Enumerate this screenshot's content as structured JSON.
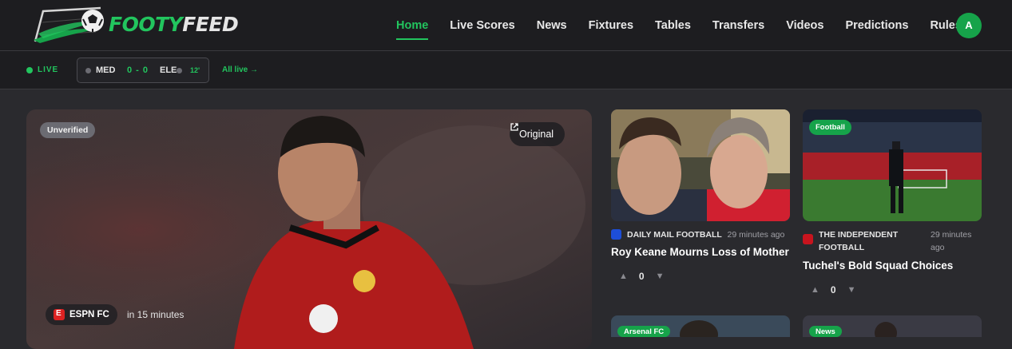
{
  "brand": {
    "name_part1": "FOOTY",
    "name_part2": "FEED"
  },
  "nav": {
    "items": [
      "Home",
      "Live Scores",
      "News",
      "Fixtures",
      "Tables",
      "Transfers",
      "Videos",
      "Predictions",
      "Rules"
    ],
    "active": "Home"
  },
  "user": {
    "initial": "A"
  },
  "live_ticker": {
    "label": "LIVE",
    "match": {
      "home": "MED",
      "score": "0 - 0",
      "away": "ELE",
      "minute": "12'"
    },
    "all_live_link": "All live →"
  },
  "hero": {
    "badge": "Unverified",
    "original_label": "Original",
    "source": "ESPN FC",
    "time": "in 15 minutes"
  },
  "cards": [
    {
      "source": "DAILY MAIL FOOTBALL",
      "time": "29 minutes ago",
      "title": "Roy Keane Mourns Loss of Mother",
      "votes": "0"
    },
    {
      "tag": "Football",
      "source_line1": "THE INDEPENDENT",
      "source_line2": "FOOTBALL",
      "time_line1": "29 minutes",
      "time_line2": "ago",
      "title": "Tuchel's Bold Squad Choices",
      "votes": "0"
    },
    {
      "tag": "Arsenal FC"
    },
    {
      "tag": "News"
    }
  ],
  "colors": {
    "accent": "#22c55e",
    "background": "#2a2a2e",
    "bar": "#1d1d20"
  }
}
